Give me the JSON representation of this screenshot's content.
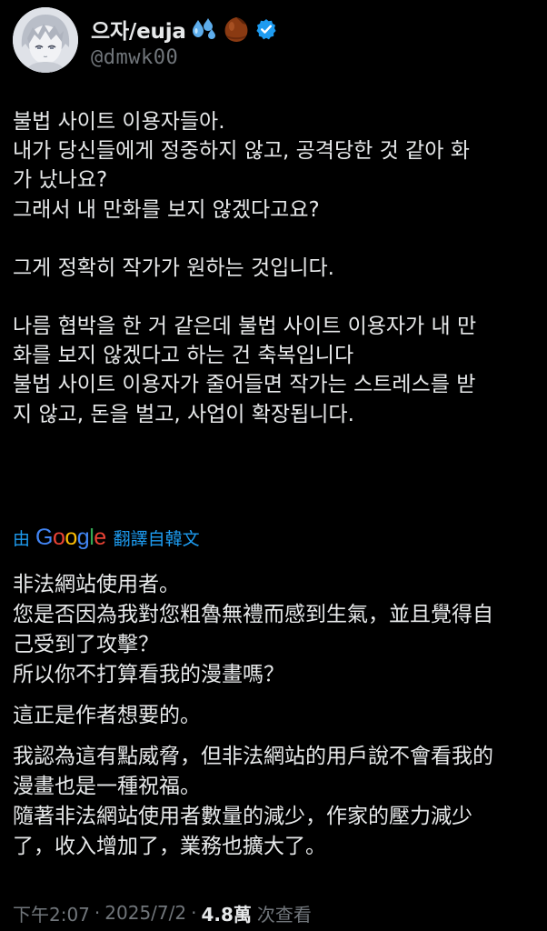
{
  "author": {
    "display_name": "으자/euja",
    "handle": "@dmwk00",
    "emoji": [
      "droplets-emoji",
      "chestnut-emoji"
    ],
    "verified": true,
    "verified_color": "#1d9bf0"
  },
  "tweet": {
    "paragraphs": [
      "불법 사이트 이용자들아.\n내가 당신들에게 정중하지 않고, 공격당한 것 같아 화\n가 났나요?\n그래서 내 만화를 보지 않겠다고요?",
      "그게 정확히 작가가 원하는 것입니다.",
      "나름 협박을 한 거 같은데 불법 사이트 이용자가 내 만\n화를 보지 않겠다고 하는 건 축복입니다\n불법 사이트 이용자가 줄어들면 작가는 스트레스를 받\n지 않고, 돈을 벌고, 사업이 확장됩니다."
    ]
  },
  "translate_bar": {
    "prefix": "由",
    "brand": "Google",
    "suffix": "翻譯自韓文",
    "accent": "#1d9bf0"
  },
  "translation": {
    "paragraphs": [
      "非法網站使用者。\n您是否因為我對您粗魯無禮而感到生氣，並且覺得自\n己受到了攻擊？\n所以你不打算看我的漫畫嗎？",
      "這正是作者想要的。",
      "我認為這有點威脅，但非法網站的用戶說不會看我的\n漫畫也是一種祝福。\n隨著非法網站使用者數量的減少，作家的壓力減少\n了，收入增加了，業務也擴大了。"
    ]
  },
  "meta": {
    "time": "下午2:07",
    "date": "2025/7/2",
    "separator": "·",
    "views_count": "4.8萬",
    "views_label": "次查看"
  }
}
